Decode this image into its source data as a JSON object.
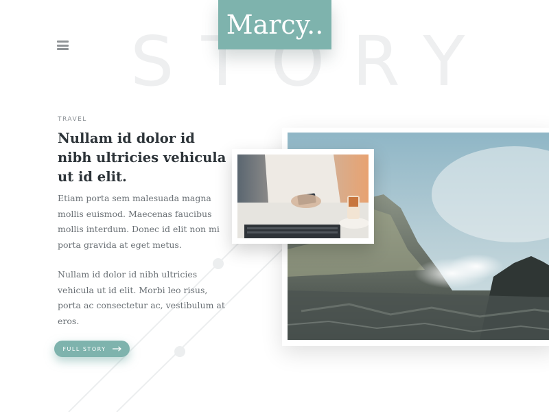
{
  "brand": {
    "logo_text": "Marcy.."
  },
  "hero": {
    "background_word": "STORY"
  },
  "article": {
    "category": "TRAVEL",
    "headline": "Nullam id dolor id nibh ultricies vehicula ut id elit.",
    "paragraphs": [
      "Etiam porta sem malesuada magna mollis euismod. Maecenas faucibus mollis interdum. Donec id elit non mi porta gravida at eget metus.",
      "Nullam id dolor id nibh ultricies vehicula ut id elit. Morbi leo risus, porta ac consectetur ac, vestibulum at eros."
    ],
    "cta_label": "FULL STORY"
  },
  "icons": {
    "menu": "menu-icon",
    "cta_arrow": "arrow-right-icon"
  },
  "colors": {
    "accent": "#7eb3ad",
    "heading": "#2c3338",
    "body_text": "#6a7075",
    "bg_word": "#eeeff0"
  }
}
